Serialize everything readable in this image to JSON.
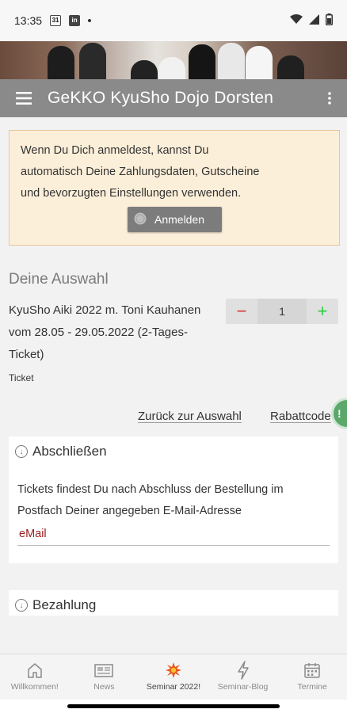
{
  "status_bar": {
    "time": "13:35",
    "calendar_badge": "31",
    "linkedin_badge": "in"
  },
  "app_bar": {
    "title": "GeKKO KyuSho Dojo Dorsten"
  },
  "login_notice": {
    "lines": [
      "Wenn Du Dich anmeldest, kannst Du",
      "automatisch Deine Zahlungsdaten, Gutscheine",
      "und bevorzugten Einstellungen verwenden."
    ],
    "button_label": "Anmelden"
  },
  "selection": {
    "heading": "Deine Auswahl",
    "item_lines": [
      "KyuSho Aiki 2022 m. Toni Kauhanen",
      "vom 28.05 - 29.05.2022 (2-Tages-",
      "Ticket)"
    ],
    "item_type": "Ticket",
    "quantity": "1",
    "minus_symbol": "−",
    "plus_symbol": "+"
  },
  "links": {
    "back": "Zurück zur Auswahl",
    "coupon": "Rabattcode"
  },
  "fab_badge": "!",
  "checkout_card": {
    "title": "Abschließen",
    "body_lines": [
      "Tickets findest Du nach Abschluss der Bestellung im",
      "Postfach Deiner angegeben E-Mail-Adresse"
    ],
    "email_label": "eMail"
  },
  "payment_card": {
    "title": "Bezahlung"
  },
  "bottom_nav": {
    "items": [
      {
        "label": "Willkommen!",
        "icon": "home-icon"
      },
      {
        "label": "News",
        "icon": "newspaper-icon"
      },
      {
        "label": "Seminar 2022!",
        "icon": "burst-icon"
      },
      {
        "label": "Seminar-Blog",
        "icon": "lightning-icon"
      },
      {
        "label": "Termine",
        "icon": "calendar-icon"
      }
    ],
    "active_index": 2
  },
  "colors": {
    "app_bar": "#8a8a8a",
    "notice_bg": "#fcefd9",
    "minus": "#d63031",
    "plus": "#2ecc40",
    "email_label": "#9b1c1c",
    "active_burst": "#e8551c"
  }
}
